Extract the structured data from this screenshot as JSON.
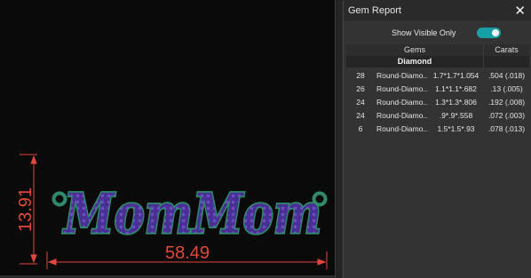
{
  "viewport": {
    "design_text": "MomMom",
    "dim_width": "58.49",
    "dim_height": "13.91",
    "colors": {
      "dimension": "#e0473d",
      "gem_fill": "#5a3aa0",
      "gem_outline": "#2f8a6c"
    }
  },
  "panel": {
    "title": "Gem Report",
    "close_icon": "close-icon",
    "toggle": {
      "label": "Show Visible Only",
      "on": true,
      "color": "#16a0a6"
    },
    "table": {
      "headers": {
        "gems": "Gems",
        "carats": "Carats"
      },
      "group": "Diamond",
      "rows": [
        {
          "count": "28",
          "name": "Round-Diamo...",
          "size": "1.7*1.7*1.054",
          "carats": ".504 (.018)"
        },
        {
          "count": "26",
          "name": "Round-Diamo...",
          "size": "1.1*1.1*.682",
          "carats": ".13 (.005)"
        },
        {
          "count": "24",
          "name": "Round-Diamo...",
          "size": "1.3*1.3*.806",
          "carats": ".192 (.008)"
        },
        {
          "count": "24",
          "name": "Round-Diamo...",
          "size": ".9*.9*.558",
          "carats": ".072 (.003)"
        },
        {
          "count": "6",
          "name": "Round-Diamo...",
          "size": "1.5*1.5*.93",
          "carats": ".078 (.013)"
        }
      ]
    }
  }
}
